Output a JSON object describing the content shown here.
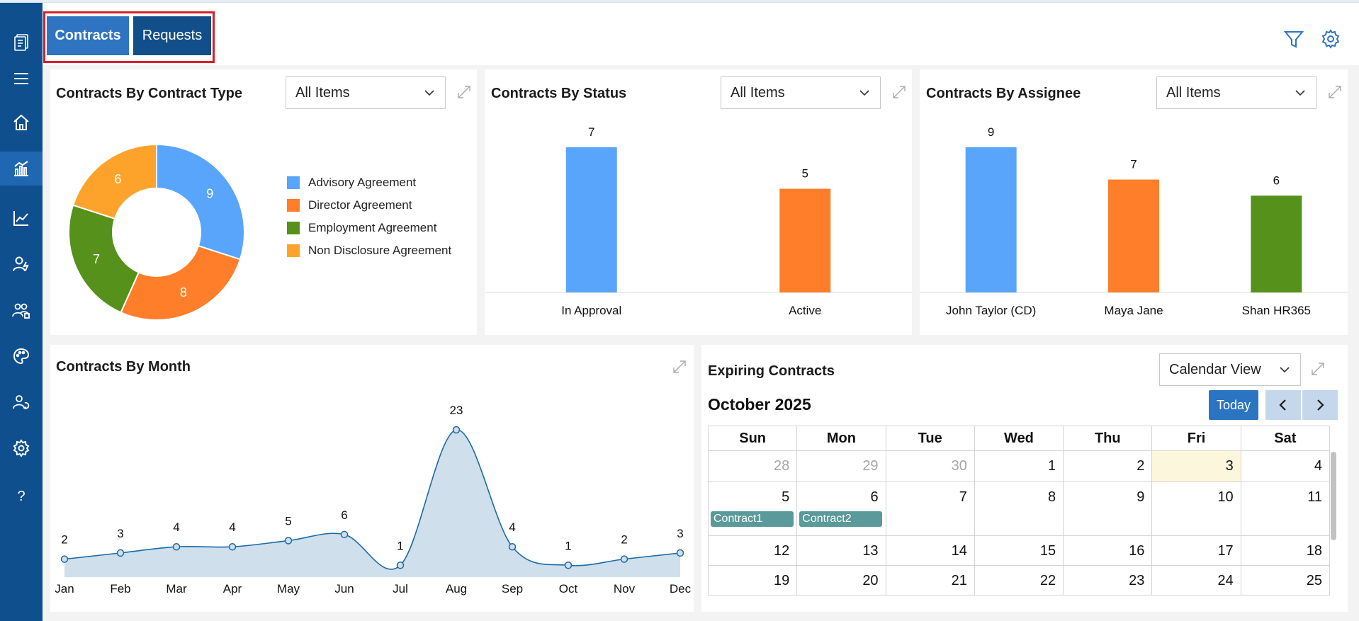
{
  "tabs": [
    {
      "label": "Contracts",
      "active": true
    },
    {
      "label": "Requests",
      "active": false
    }
  ],
  "sidebar": {
    "items": [
      {
        "icon": "logo-icon"
      },
      {
        "icon": "hamburger-menu-icon"
      },
      {
        "icon": "home-icon"
      },
      {
        "icon": "dashboard-chart-icon",
        "active": true
      },
      {
        "icon": "line-chart-icon"
      },
      {
        "icon": "user-activity-icon"
      },
      {
        "icon": "users-group-icon"
      },
      {
        "icon": "palette-icon"
      },
      {
        "icon": "user-sync-icon"
      },
      {
        "icon": "settings-icon"
      },
      {
        "icon": "help-icon"
      }
    ],
    "color": "#0f4f8e",
    "active_color": "#1f67b1"
  },
  "header": {
    "icons": [
      "filter-icon",
      "gear-icon"
    ],
    "accent": "#2f74c0"
  },
  "cards": {
    "type": {
      "title": "Contracts By Contract Type",
      "filter": "All Items"
    },
    "status": {
      "title": "Contracts By Status",
      "filter": "All Items"
    },
    "assignee": {
      "title": "Contracts By Assignee",
      "filter": "All Items"
    },
    "month": {
      "title": "Contracts By Month"
    },
    "expiring": {
      "title": "Expiring Contracts",
      "view": "Calendar View"
    }
  },
  "colors": {
    "blue": "#58a5fb",
    "orange": "#fe7e2a",
    "green": "#55911b",
    "yellow": "#fda32c",
    "line": "#1b6aa5",
    "area": "#cfdfec"
  },
  "chart_data": [
    {
      "type": "pie",
      "title": "Contracts By Contract Type",
      "categories": [
        "Advisory Agreement",
        "Director Agreement",
        "Employment Agreement",
        "Non Disclosure Agreement"
      ],
      "values": [
        9,
        8,
        7,
        6
      ],
      "donut": true,
      "legend": "right"
    },
    {
      "type": "bar",
      "title": "Contracts By Status",
      "categories": [
        "In Approval",
        "Active"
      ],
      "values": [
        7,
        5
      ],
      "ylim": [
        0,
        7
      ]
    },
    {
      "type": "bar",
      "title": "Contracts By Assignee",
      "categories": [
        "John Taylor (CD)",
        "Maya Jane",
        "Shan HR365"
      ],
      "values": [
        9,
        7,
        6
      ],
      "ylim": [
        0,
        9
      ]
    },
    {
      "type": "area",
      "title": "Contracts By Month",
      "categories": [
        "Jan",
        "Feb",
        "Mar",
        "Apr",
        "May",
        "Jun",
        "Jul",
        "Aug",
        "Sep",
        "Oct",
        "Nov",
        "Dec"
      ],
      "values": [
        2,
        3,
        4,
        4,
        5,
        6,
        1,
        23,
        4,
        1,
        2,
        3
      ],
      "ylim": [
        0,
        23
      ]
    }
  ],
  "calendar": {
    "month_label": "October 2025",
    "today_label": "Today",
    "weekdays": [
      "Sun",
      "Mon",
      "Tue",
      "Wed",
      "Thu",
      "Fri",
      "Sat"
    ],
    "weeks": [
      [
        {
          "d": "28",
          "other": true
        },
        {
          "d": "29",
          "other": true
        },
        {
          "d": "30",
          "other": true
        },
        {
          "d": "1"
        },
        {
          "d": "2"
        },
        {
          "d": "3",
          "today": true
        },
        {
          "d": "4"
        }
      ],
      [
        {
          "d": "5",
          "event": "Contract1"
        },
        {
          "d": "6",
          "event": "Contract2"
        },
        {
          "d": "7"
        },
        {
          "d": "8"
        },
        {
          "d": "9"
        },
        {
          "d": "10"
        },
        {
          "d": "11"
        }
      ],
      [
        {
          "d": "12"
        },
        {
          "d": "13"
        },
        {
          "d": "14"
        },
        {
          "d": "15"
        },
        {
          "d": "16"
        },
        {
          "d": "17"
        },
        {
          "d": "18"
        }
      ],
      [
        {
          "d": "19"
        },
        {
          "d": "20"
        },
        {
          "d": "21"
        },
        {
          "d": "22"
        },
        {
          "d": "23"
        },
        {
          "d": "24"
        },
        {
          "d": "25"
        }
      ]
    ]
  }
}
